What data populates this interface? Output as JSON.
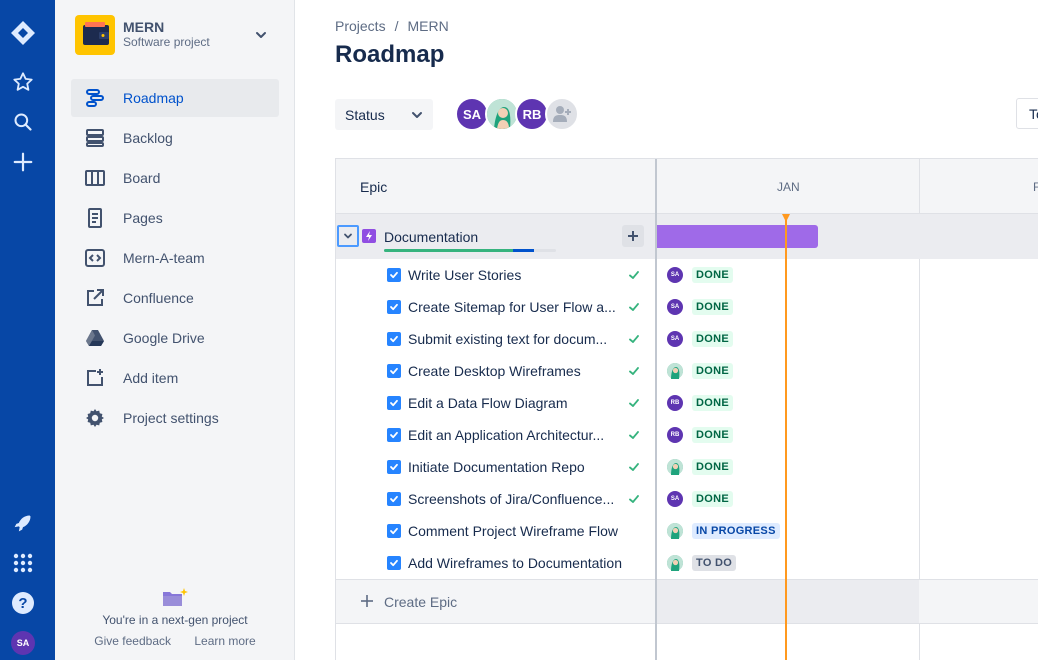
{
  "project": {
    "name": "MERN",
    "type": "Software project"
  },
  "sidebar": {
    "items": [
      {
        "label": "Roadmap",
        "icon": "roadmap-icon",
        "active": true
      },
      {
        "label": "Backlog",
        "icon": "backlog-icon"
      },
      {
        "label": "Board",
        "icon": "board-icon"
      },
      {
        "label": "Pages",
        "icon": "pages-icon"
      },
      {
        "label": "Mern-A-team",
        "icon": "code-icon"
      },
      {
        "label": "Confluence",
        "icon": "external-link-icon"
      },
      {
        "label": "Google Drive",
        "icon": "google-drive-icon"
      },
      {
        "label": "Add item",
        "icon": "add-item-icon"
      },
      {
        "label": "Project settings",
        "icon": "gear-icon"
      }
    ],
    "footer": {
      "message": "You're in a next-gen project",
      "feedback": "Give feedback",
      "learn": "Learn more"
    }
  },
  "global_nav": {
    "user_initials": "SA"
  },
  "breadcrumb": {
    "projects": "Projects",
    "separator": "/",
    "current": "MERN"
  },
  "page": {
    "title": "Roadmap"
  },
  "toolbar": {
    "status_label": "Status",
    "truncated_button": "To"
  },
  "assignees": [
    {
      "initials": "SA"
    },
    {
      "initials": ""
    },
    {
      "initials": "RB"
    }
  ],
  "roadmap": {
    "epic_header": "Epic",
    "months": [
      "JAN",
      "F"
    ],
    "epic": {
      "name": "Documentation",
      "progress_done": 0.75,
      "progress_in_progress": 0.12
    },
    "issues": [
      {
        "title": "Write User Stories",
        "assignee": "SA",
        "status": "DONE",
        "resolved": true
      },
      {
        "title": "Create Sitemap for User Flow a...",
        "assignee": "SA",
        "status": "DONE",
        "resolved": true
      },
      {
        "title": "Submit existing text for docum...",
        "assignee": "SA",
        "status": "DONE",
        "resolved": true
      },
      {
        "title": "Create Desktop Wireframes",
        "assignee": "",
        "status": "DONE",
        "resolved": true
      },
      {
        "title": "Edit a Data Flow Diagram",
        "assignee": "RB",
        "status": "DONE",
        "resolved": true
      },
      {
        "title": "Edit an Application Architectur...",
        "assignee": "RB",
        "status": "DONE",
        "resolved": true
      },
      {
        "title": "Initiate Documentation Repo",
        "assignee": "",
        "status": "DONE",
        "resolved": true
      },
      {
        "title": "Screenshots of Jira/Confluence...",
        "assignee": "SA",
        "status": "DONE",
        "resolved": true
      },
      {
        "title": "Comment Project Wireframe Flow",
        "assignee": "",
        "status": "IN PROGRESS",
        "resolved": false
      },
      {
        "title": "Add Wireframes to Documentation",
        "assignee": "",
        "status": "TO DO",
        "resolved": false
      }
    ],
    "create_epic": "Create Epic"
  },
  "colors": {
    "global_nav": "#0747a6",
    "epic_bar": "#9f6ae8",
    "today_marker": "#ff991f",
    "done": "#006644",
    "in_progress": "#0747a6"
  }
}
